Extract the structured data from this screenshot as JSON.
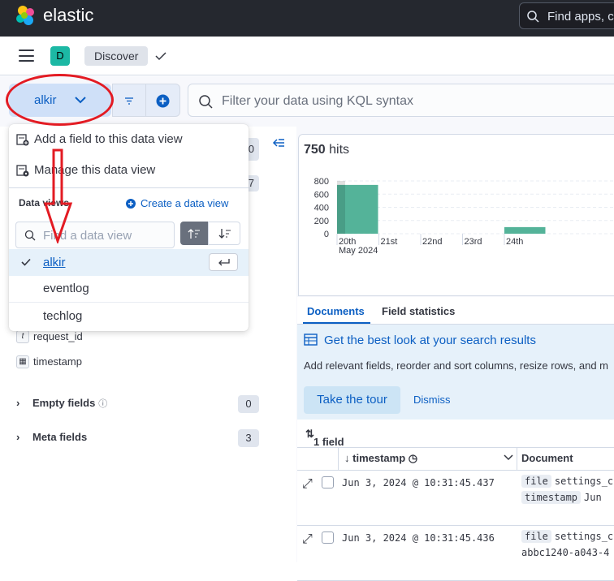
{
  "header": {
    "brand": "elastic",
    "search_placeholder": "Find apps, c"
  },
  "subheader": {
    "space_initial": "D",
    "breadcrumb": "Discover"
  },
  "query_bar": {
    "data_view_label": "alkir",
    "kql_placeholder": "Filter your data using KQL syntax"
  },
  "popover": {
    "add_field": "Add a field to this data view",
    "manage": "Manage this data view",
    "title": "Data views",
    "create": "Create a data view",
    "find_placeholder": "Find a data view",
    "items": [
      {
        "label": "alkir",
        "selected": true
      },
      {
        "label": "eventlog",
        "selected": false
      },
      {
        "label": "techlog",
        "selected": false
      }
    ]
  },
  "sidebar": {
    "badge_top": "0",
    "badge_second": "7",
    "fields": [
      {
        "type": "t",
        "name": "request_id"
      },
      {
        "type": "date",
        "name": "timestamp"
      }
    ],
    "empty_fields": {
      "label": "Empty fields",
      "count": "0"
    },
    "meta_fields": {
      "label": "Meta fields",
      "count": "3"
    }
  },
  "results": {
    "hits_count": "750",
    "hits_label": "hits",
    "tabs": [
      "Documents",
      "Field statistics"
    ],
    "callout_title": "Get the best look at your search results",
    "callout_body": "Add relevant fields, reorder and sort columns, resize rows, and m",
    "tour_button": "Take the tour",
    "dismiss": "Dismiss",
    "sorted_label": "1 field sorted",
    "col_timestamp": "timestamp",
    "col_document": "Document",
    "rows": [
      {
        "ts": "Jun 3, 2024 @ 10:31:45.437",
        "key1": "file",
        "val1": "settings_c",
        "key2": "timestamp",
        "val2": "Jun"
      },
      {
        "ts": "Jun 3, 2024 @ 10:31:45.436",
        "key1": "file",
        "val1": "settings_c",
        "key2": "",
        "val2": "abbc1240-a043-4"
      }
    ]
  },
  "chart_data": {
    "type": "bar",
    "categories": [
      "20th",
      "21st",
      "22nd",
      "23rd",
      "24th"
    ],
    "values": [
      740,
      0,
      0,
      0,
      100
    ],
    "date_label": "May 2024",
    "y_ticks": [
      "800",
      "600",
      "400",
      "200",
      "0"
    ],
    "ylim": [
      0,
      800
    ],
    "color": "#54b399"
  },
  "colors": {
    "accent": "#0c5fc3",
    "annotation": "#e31b23",
    "header_bg": "#25282f"
  }
}
